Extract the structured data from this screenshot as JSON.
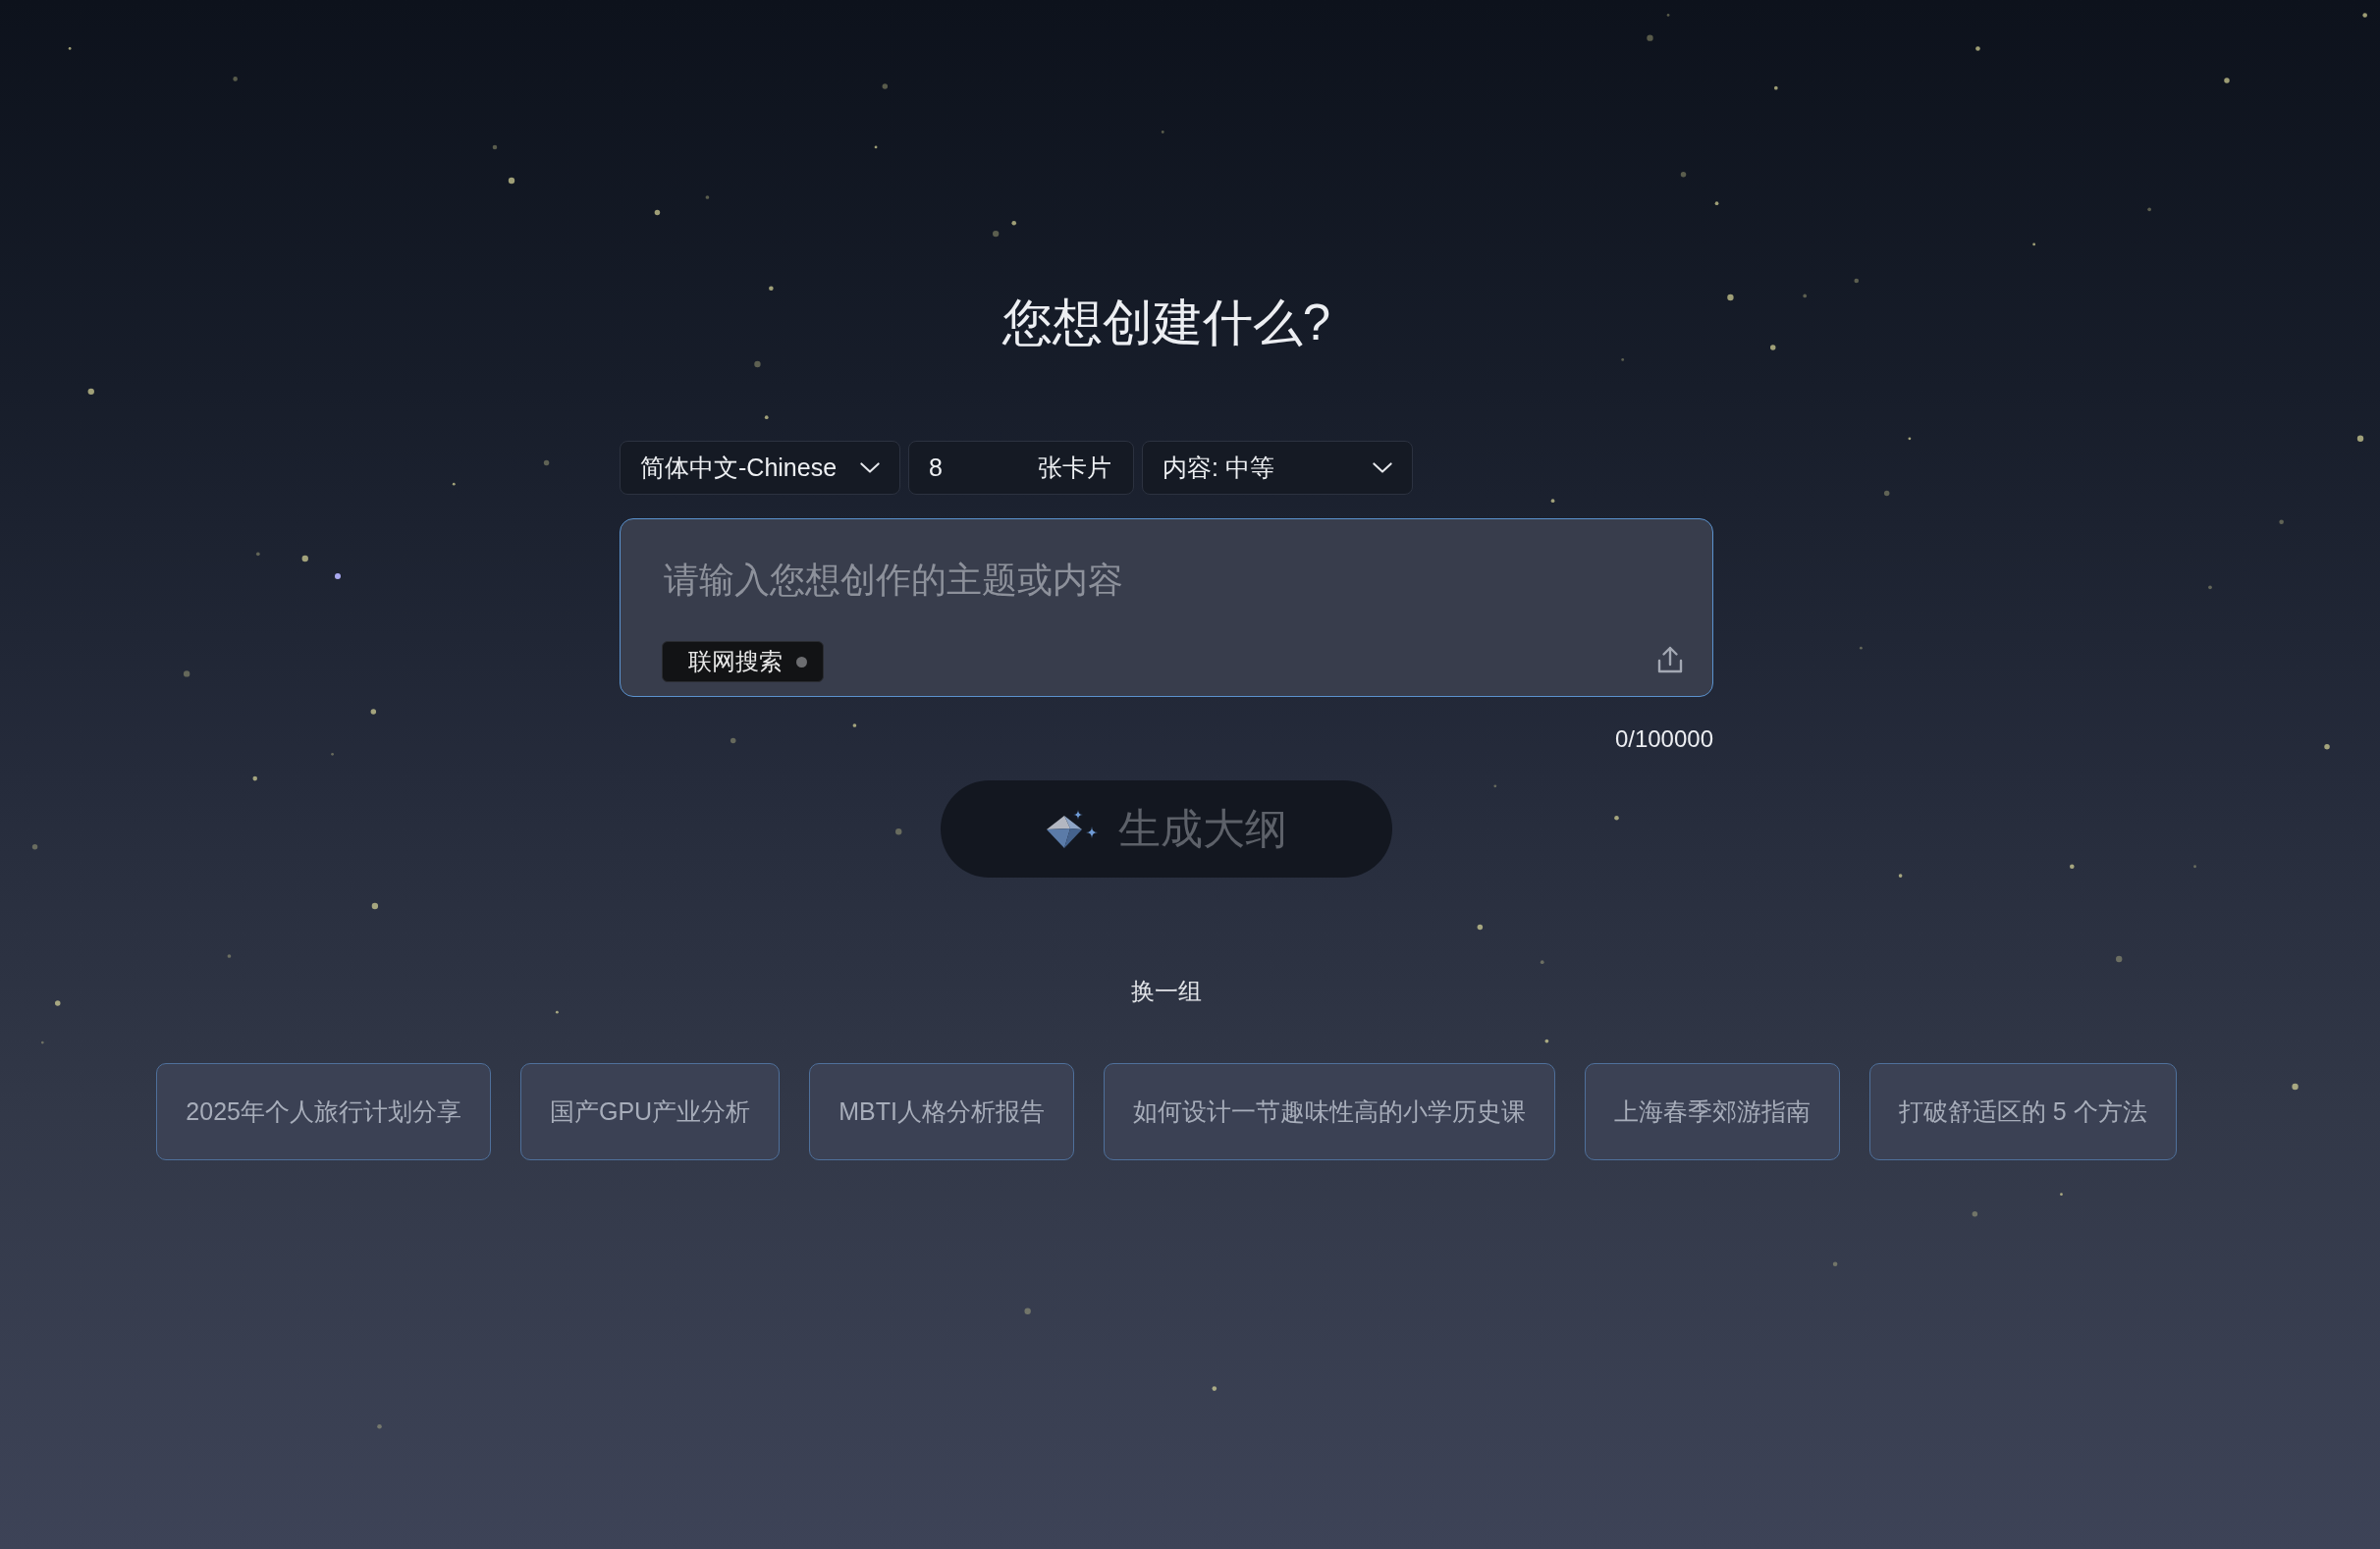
{
  "title": "您想创建什么?",
  "options": [
    {
      "kind": "select",
      "value": "简体中文-Chinese"
    },
    {
      "kind": "number",
      "value": "8",
      "suffix": "张卡片"
    },
    {
      "kind": "select",
      "value": "内容: 中等"
    }
  ],
  "prompt": {
    "placeholder": "请输入您想创作的主题或内容",
    "web_search": {
      "label": "联网搜索",
      "on": false
    },
    "counter": "0/100000"
  },
  "generate_button": {
    "label": "生成大纲",
    "disabled": true
  },
  "shuffle": "换一组",
  "suggestions": [
    "2025年个人旅行计划分享",
    "国产GPU产业分析",
    "MBTI人格分析报告",
    "如何设计一节趣味性高的小学历史课",
    "上海春季郊游指南",
    "打破舒适区的 5 个方法"
  ]
}
